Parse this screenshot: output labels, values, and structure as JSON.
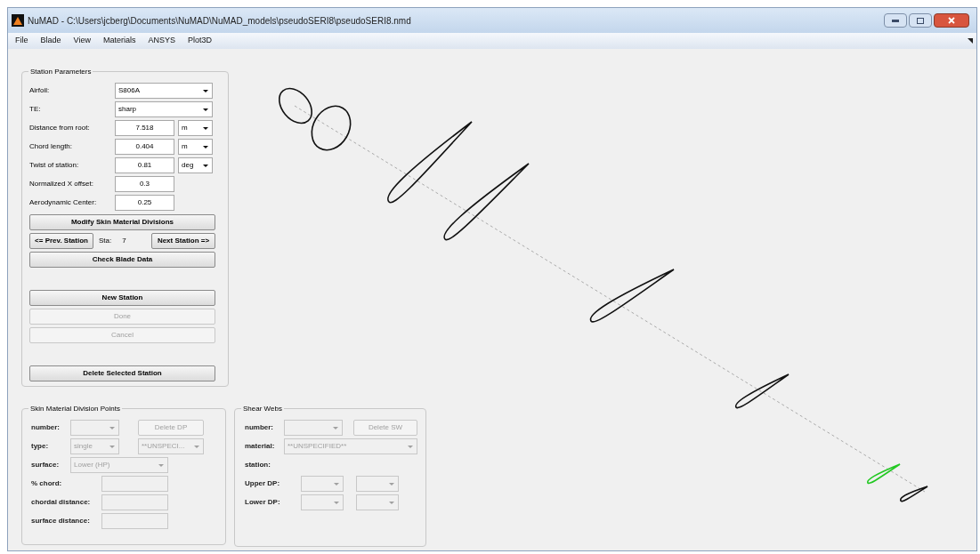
{
  "window": {
    "title": "NuMAD - C:\\Users\\jcberg\\Documents\\NuMAD\\NuMAD_models\\pseudoSERI8\\pseudoSERI8.nmd"
  },
  "menu": [
    "File",
    "Blade",
    "View",
    "Materials",
    "ANSYS",
    "Plot3D"
  ],
  "station_parameters": {
    "title": "Station Parameters",
    "fields": [
      {
        "label": "Airfoil:",
        "kind": "select",
        "value": "S806A"
      },
      {
        "label": "TE:",
        "kind": "select",
        "value": "sharp"
      },
      {
        "label": "Distance from root:",
        "kind": "number_unit",
        "value": "7.518",
        "unit": "m"
      },
      {
        "label": "Chord length:",
        "kind": "number_unit",
        "value": "0.404",
        "unit": "m"
      },
      {
        "label": "Twist of station:",
        "kind": "number_unit",
        "value": "0.81",
        "unit": "deg"
      },
      {
        "label": "Normalized X offset:",
        "kind": "number",
        "value": "0.3"
      },
      {
        "label": "Aerodynamic Center:",
        "kind": "number",
        "value": "0.25"
      }
    ],
    "modify_button": "Modify Skin Material Divisions",
    "nav": {
      "prev": "<= Prev. Station",
      "sta_label": "Sta:",
      "sta_value": "7",
      "next": "Next Station =>"
    },
    "check_button": "Check Blade Data",
    "actions": [
      {
        "label": "New Station",
        "disabled": false
      },
      {
        "label": "Done",
        "disabled": true
      },
      {
        "label": "Cancel",
        "disabled": true
      }
    ],
    "delete_button": "Delete Selected Station"
  },
  "skin_divisions": {
    "title": "Skin Material Division Points",
    "rows": [
      {
        "label": "number:",
        "controls": [
          {
            "kind": "select",
            "disabled": true
          },
          {
            "kind": "button",
            "value": "Delete DP",
            "disabled": true
          }
        ]
      },
      {
        "label": "type:",
        "controls": [
          {
            "kind": "select",
            "value": "single",
            "disabled": true
          },
          {
            "kind": "select",
            "value": "**UNSPECI...",
            "disabled": true
          }
        ]
      },
      {
        "label": "surface:",
        "controls": [
          {
            "kind": "select",
            "value": "Lower (HP)",
            "disabled": true
          }
        ]
      },
      {
        "label": "% chord:",
        "controls": [
          {
            "kind": "input",
            "disabled": true
          }
        ]
      },
      {
        "label": "chordal distance:",
        "controls": [
          {
            "kind": "input",
            "disabled": true
          }
        ]
      },
      {
        "label": "surface distance:",
        "controls": [
          {
            "kind": "input",
            "disabled": true
          }
        ]
      }
    ]
  },
  "shear_webs": {
    "title": "Shear Webs",
    "rows": [
      {
        "label": "number:",
        "controls": [
          {
            "kind": "select",
            "disabled": true
          },
          {
            "kind": "button",
            "value": "Delete SW",
            "disabled": true
          }
        ]
      },
      {
        "label": "material:",
        "controls": [
          {
            "kind": "select",
            "value": "**UNSPECIFIED**",
            "disabled": true
          }
        ]
      },
      {
        "label": "station:",
        "controls": []
      },
      {
        "label": "Upper DP:",
        "controls": [
          {
            "kind": "select",
            "disabled": true
          },
          {
            "kind": "select",
            "disabled": true
          }
        ]
      },
      {
        "label": "Lower DP:",
        "controls": [
          {
            "kind": "select",
            "disabled": true
          },
          {
            "kind": "select",
            "disabled": true
          }
        ]
      }
    ]
  },
  "plot": {
    "stations": [
      {
        "selected": false
      },
      {
        "selected": false
      },
      {
        "selected": false
      },
      {
        "selected": false
      },
      {
        "selected": false
      },
      {
        "selected": false
      },
      {
        "selected": true
      },
      {
        "selected": false
      }
    ]
  }
}
